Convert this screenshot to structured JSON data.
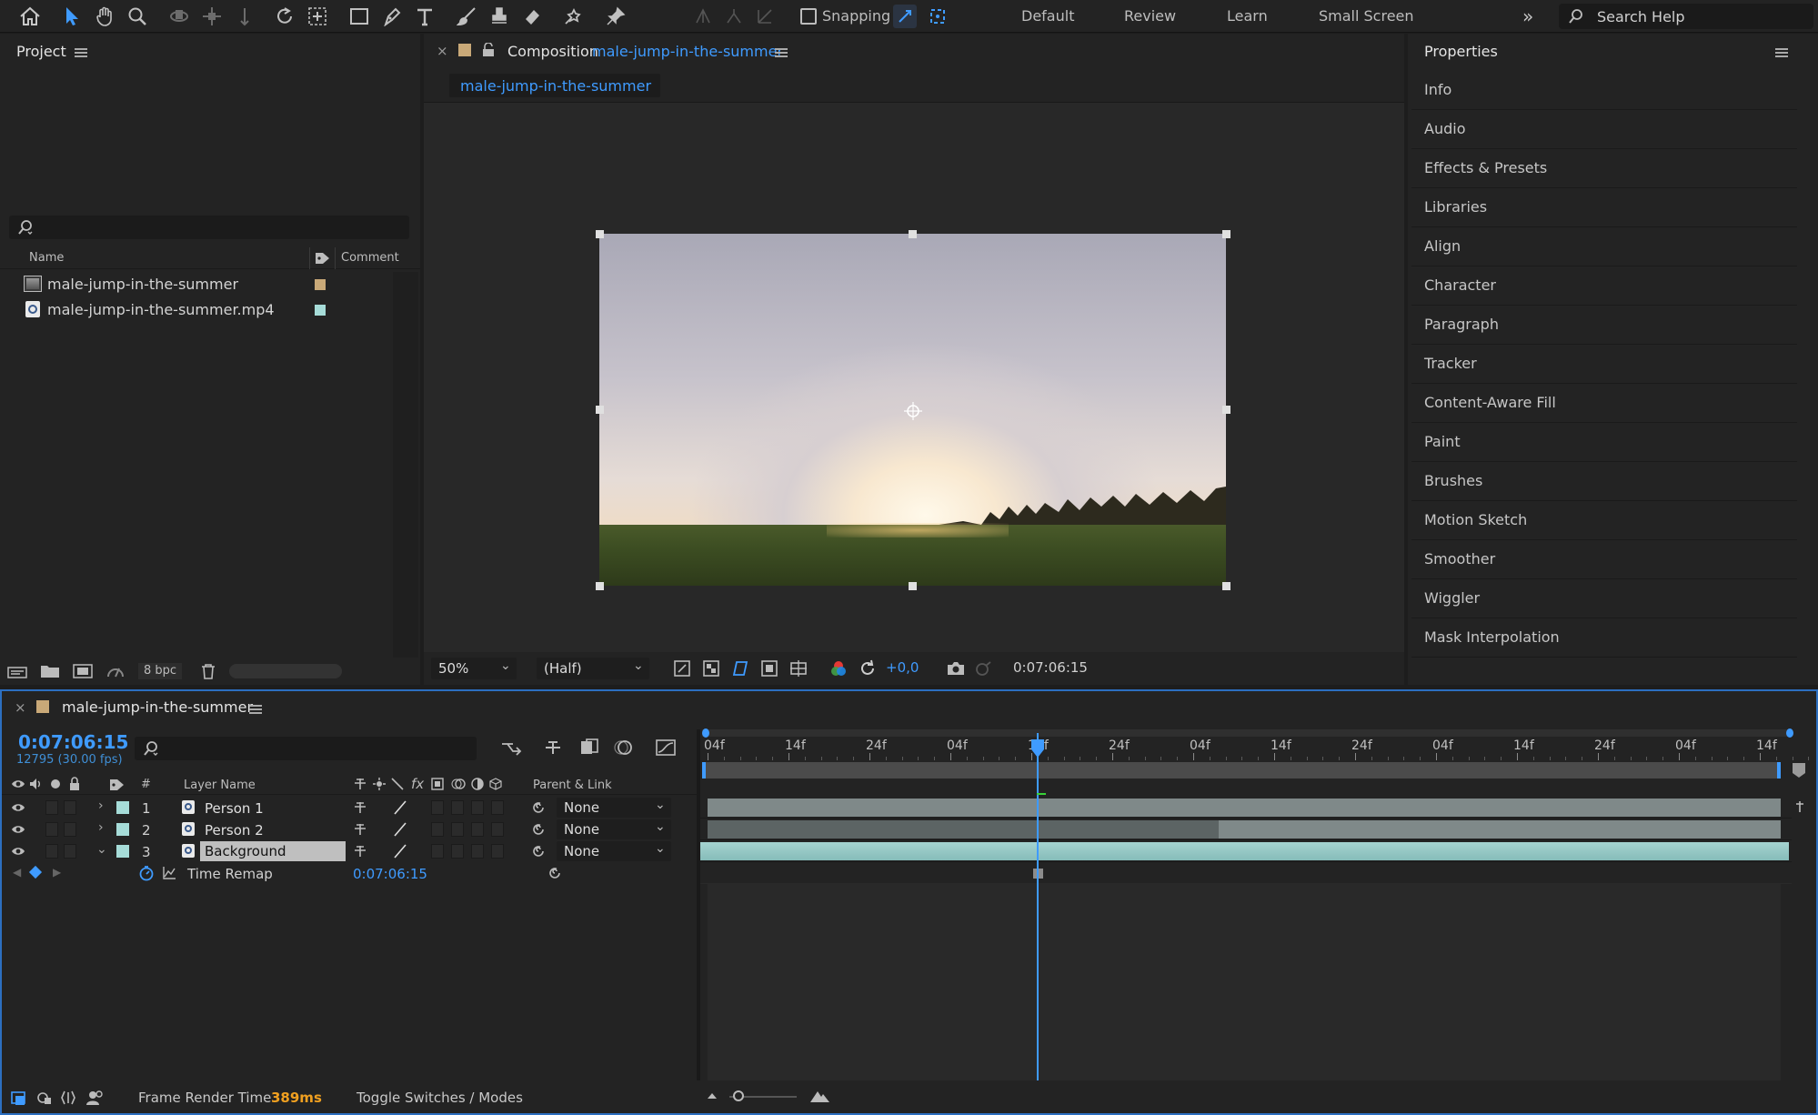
{
  "toolbar": {
    "tools": [
      "home-icon",
      "selection-tool-icon",
      "hand-tool-icon",
      "zoom-tool-icon",
      "orbit-camera-icon",
      "pan-camera-icon",
      "dolly-camera-icon",
      "rotate-tool-icon",
      "pan-behind-icon",
      "rectangle-tool-icon",
      "pen-tool-icon",
      "type-tool-icon",
      "brush-tool-icon",
      "clone-stamp-icon",
      "eraser-icon",
      "roto-brush-icon",
      "puppet-pin-icon"
    ],
    "snapping_label": "Snapping",
    "workspaces": [
      "Default",
      "Review",
      "Learn",
      "Small Screen"
    ],
    "search_placeholder": "Search Help"
  },
  "project": {
    "title": "Project",
    "columns": {
      "name": "Name",
      "comment": "Comment"
    },
    "items": [
      {
        "name": "male-jump-in-the-summer",
        "type": "composition",
        "label_color": "#c9a978"
      },
      {
        "name": "male-jump-in-the-summer.mp4",
        "type": "footage",
        "label_color": "#a6dcd8"
      }
    ],
    "bpc": "8 bpc"
  },
  "composition": {
    "panel_label": "Composition",
    "name": "male-jump-in-the-summer",
    "tab": "male-jump-in-the-summer",
    "zoom": "50%",
    "resolution": "(Half)",
    "exposure": "+0,0",
    "timecode": "0:07:06:15"
  },
  "properties": {
    "title": "Properties",
    "items": [
      "Info",
      "Audio",
      "Effects & Presets",
      "Libraries",
      "Align",
      "Character",
      "Paragraph",
      "Tracker",
      "Content-Aware Fill",
      "Paint",
      "Brushes",
      "Motion Sketch",
      "Smoother",
      "Wiggler",
      "Mask Interpolation"
    ]
  },
  "timeline": {
    "comp_name": "male-jump-in-the-summer",
    "timecode": "0:07:06:15",
    "frame_info": "12795 (30.00 fps)",
    "headers": {
      "num": "#",
      "layer_name": "Layer Name",
      "parent": "Parent & Link"
    },
    "layers": [
      {
        "num": "1",
        "name": "Person 1",
        "parent": "None",
        "expanded": false
      },
      {
        "num": "2",
        "name": "Person 2",
        "parent": "None",
        "expanded": false
      },
      {
        "num": "3",
        "name": "Background",
        "parent": "None",
        "expanded": true
      }
    ],
    "time_remap": {
      "label": "Time Remap",
      "value": "0:07:06:15"
    },
    "ruler": [
      "04f",
      "14f",
      "24f",
      "04f",
      "14f",
      "24f",
      "04f",
      "14f",
      "24f",
      "04f",
      "14f",
      "24f",
      "04f",
      "14f"
    ],
    "frame_render_label": "Frame Render Time",
    "frame_render_value": "389ms",
    "toggle_label": "Toggle Switches / Modes"
  },
  "colors": {
    "accent": "#3f9bff",
    "label_aqua": "#a6dcd8",
    "label_tan": "#c9a978",
    "render_time": "#f0a020"
  }
}
